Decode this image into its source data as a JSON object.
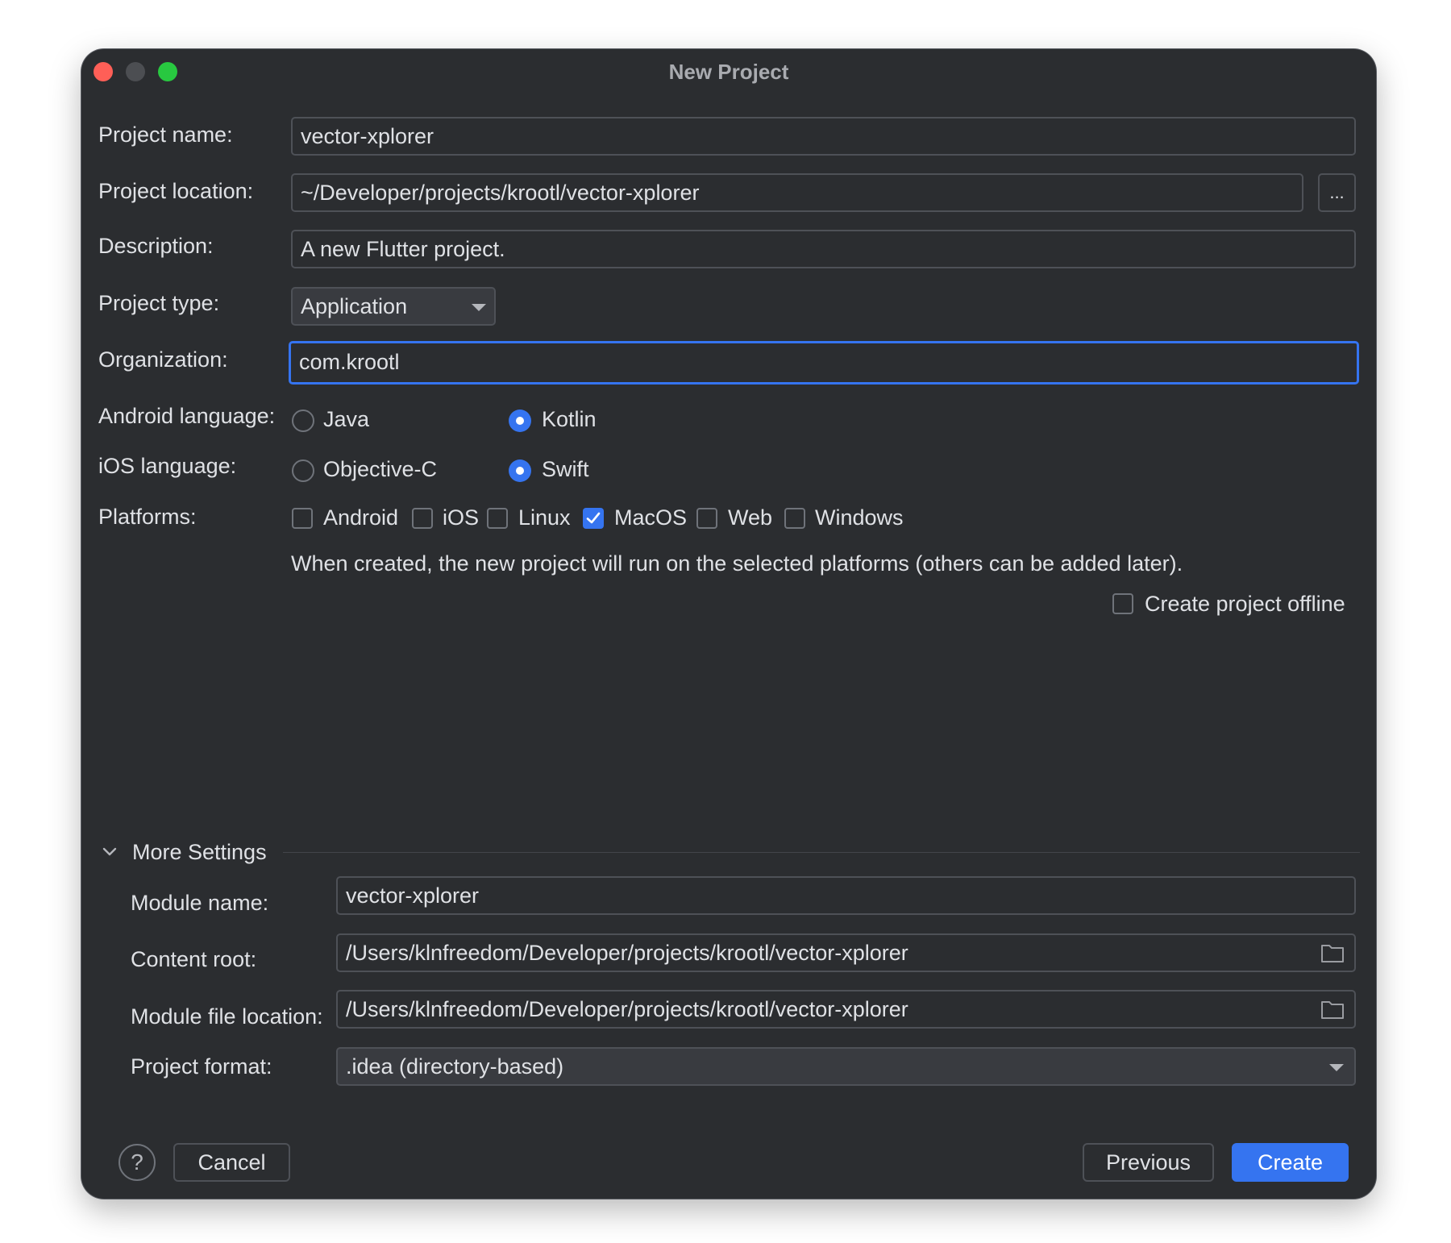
{
  "window": {
    "title": "New Project"
  },
  "form": {
    "project_name": {
      "label": "Project name:",
      "value": "vector-xplorer"
    },
    "project_location": {
      "label": "Project location:",
      "value": "~/Developer/projects/krootl/vector-xplorer",
      "browse_label": "..."
    },
    "description": {
      "label": "Description:",
      "value": "A new Flutter project."
    },
    "project_type": {
      "label": "Project type:",
      "value": "Application"
    },
    "organization": {
      "label": "Organization:",
      "value": "com.krootl"
    },
    "android_language": {
      "label": "Android language:",
      "options": [
        {
          "label": "Java",
          "selected": false
        },
        {
          "label": "Kotlin",
          "selected": true
        }
      ]
    },
    "ios_language": {
      "label": "iOS language:",
      "options": [
        {
          "label": "Objective-C",
          "selected": false
        },
        {
          "label": "Swift",
          "selected": true
        }
      ]
    },
    "platforms": {
      "label": "Platforms:",
      "options": [
        {
          "label": "Android",
          "checked": false
        },
        {
          "label": "iOS",
          "checked": false
        },
        {
          "label": "Linux",
          "checked": false
        },
        {
          "label": "MacOS",
          "checked": true
        },
        {
          "label": "Web",
          "checked": false
        },
        {
          "label": "Windows",
          "checked": false
        }
      ],
      "hint": "When created, the new project will run on the selected platforms (others can be added later)."
    },
    "create_offline": {
      "label": "Create project offline",
      "checked": false
    }
  },
  "more_settings": {
    "title": "More Settings",
    "expanded": true,
    "module_name": {
      "label": "Module name:",
      "value": "vector-xplorer"
    },
    "content_root": {
      "label": "Content root:",
      "value": "/Users/klnfreedom/Developer/projects/krootl/vector-xplorer"
    },
    "module_file_location": {
      "label": "Module file location:",
      "value": "/Users/klnfreedom/Developer/projects/krootl/vector-xplorer"
    },
    "project_format": {
      "label": "Project format:",
      "value": ".idea (directory-based)"
    }
  },
  "footer": {
    "help_label": "?",
    "cancel_label": "Cancel",
    "previous_label": "Previous",
    "create_label": "Create"
  },
  "colors": {
    "background": "#2b2d30",
    "accent": "#3574f0",
    "text": "#dfe1e5",
    "border": "#4e5157"
  }
}
